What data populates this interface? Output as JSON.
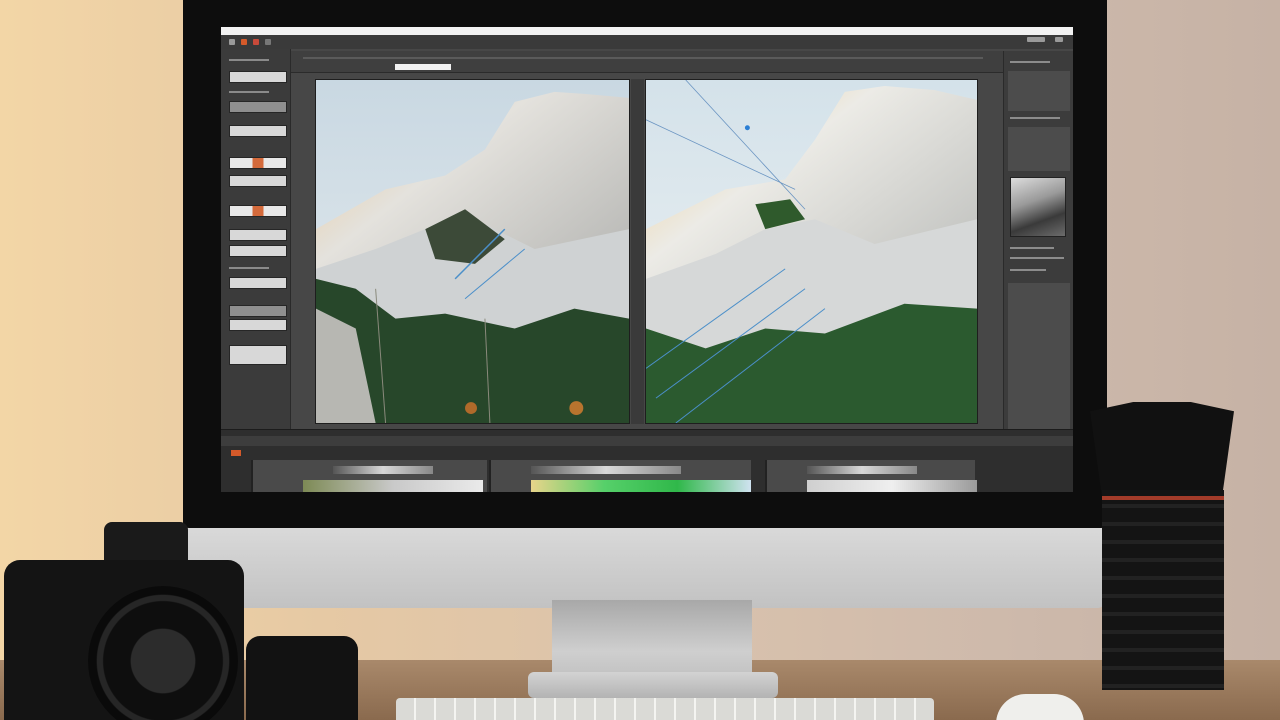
{
  "app": {
    "title": "",
    "menu_colors": [
      "#d55a2a",
      "#e8e8e8",
      "#c84a3a"
    ]
  },
  "toolbar": {
    "active_tab_label": ""
  },
  "icons": [
    "camera-icon",
    "lens-icon"
  ],
  "scene": {
    "left_photo_alt": "",
    "right_photo_alt": ""
  },
  "colors": {
    "accent": "#d55a2a",
    "panel": "#3b3b3b",
    "desk": "#8a6a4e"
  }
}
